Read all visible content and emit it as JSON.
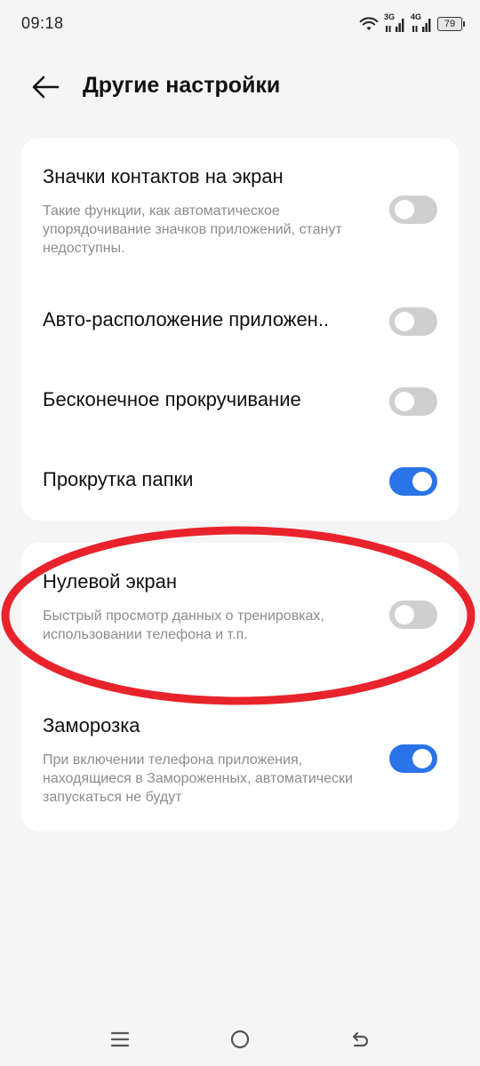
{
  "status_bar": {
    "time": "09:18",
    "network_1": "3G",
    "network_2": "4G",
    "battery": "79",
    "icons": [
      "wifi-icon",
      "signal-icon",
      "signal-icon",
      "battery-icon"
    ]
  },
  "header": {
    "back_icon": "arrow-left-icon",
    "title": "Другие настройки"
  },
  "card_1": {
    "items": [
      {
        "title": "Значки контактов на экран",
        "description": "Такие функции, как автоматическое упорядочивание значков приложений, станут недоступны.",
        "enabled": false
      },
      {
        "title": "Авто-расположение приложен..",
        "enabled": false
      },
      {
        "title": "Бесконечное прокручивание",
        "enabled": false
      },
      {
        "title": "Прокрутка папки",
        "enabled": true
      }
    ]
  },
  "card_2": {
    "items": [
      {
        "title": "Нулевой экран",
        "description": "Быстрый просмотр данных о тренировках, использовании телефона и т.п.",
        "enabled": false
      },
      {
        "title": "Заморозка",
        "description": "При включении телефона приложения, находящиеся в Замороженных, автоматически запускаться не будут",
        "enabled": true
      }
    ]
  },
  "colors": {
    "accent": "#2a73e8",
    "toggle_off": "#cfcfcf",
    "annotation": "#e8232b",
    "background": "#f5f5f5"
  },
  "nav_bar": {
    "icons": [
      "menu-icon",
      "home-icon",
      "back-icon"
    ]
  }
}
